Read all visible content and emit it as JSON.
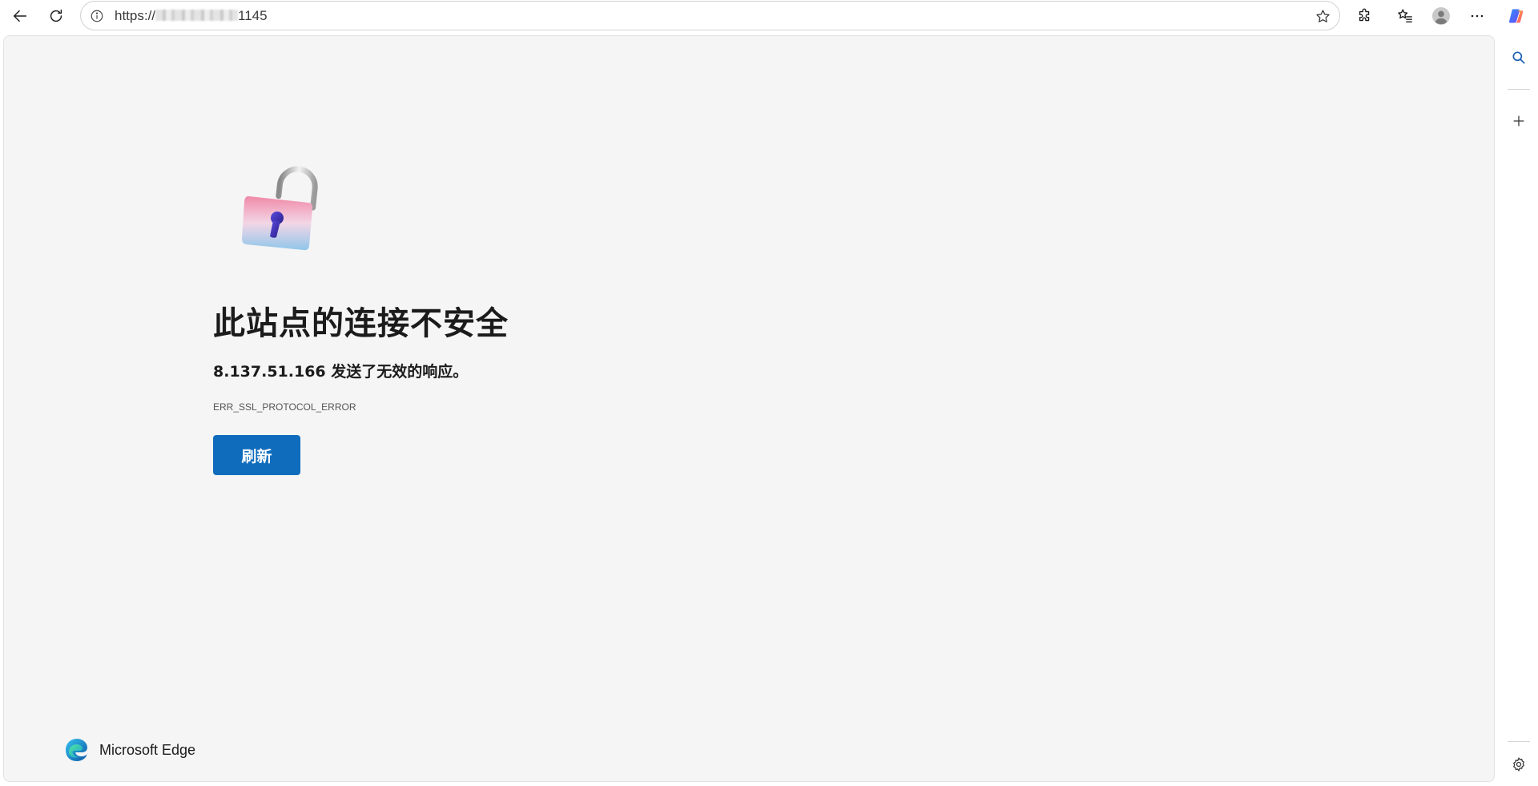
{
  "toolbar": {
    "back_icon": "back-arrow-icon",
    "refresh_icon": "refresh-icon",
    "address": {
      "info_icon": "info-icon",
      "url_prefix": "https://",
      "url_suffix": "1145",
      "favorite_icon": "star-icon"
    },
    "extensions_icon": "puzzle-icon",
    "favorites_icon": "favorites-list-icon",
    "profile_icon": "avatar-icon",
    "more_icon": "ellipsis-icon",
    "copilot_icon": "copilot-icon"
  },
  "error_page": {
    "lock_icon": "unlocked-padlock-icon",
    "title": "此站点的连接不安全",
    "description": "8.137.51.166 发送了无效的响应。",
    "error_code": "ERR_SSL_PROTOCOL_ERROR",
    "refresh_label": "刷新",
    "accent_color": "#0f6cbd"
  },
  "footer": {
    "brand_name": "Microsoft Edge"
  },
  "sidebar": {
    "search_icon": "search-icon",
    "add_icon": "plus-icon",
    "settings_icon": "gear-icon"
  }
}
